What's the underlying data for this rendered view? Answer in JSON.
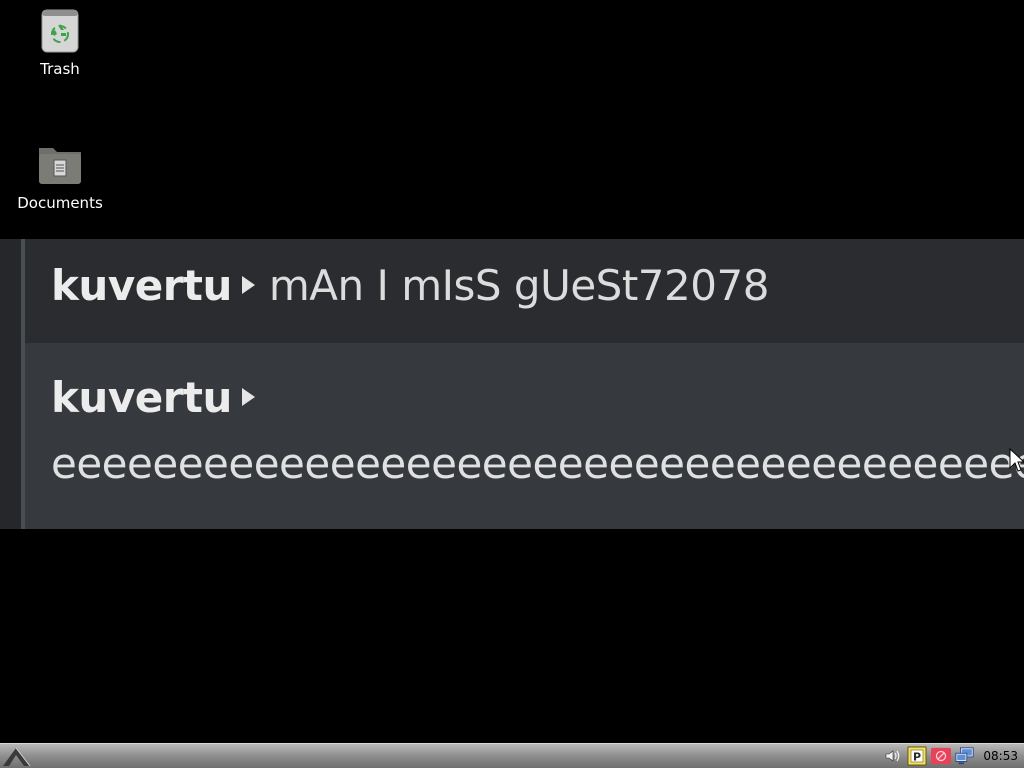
{
  "desktop": {
    "icons": [
      {
        "id": "trash",
        "label": "Trash",
        "icon": "trash-icon"
      },
      {
        "id": "documents",
        "label": "Documents",
        "icon": "folder-documents-icon"
      }
    ]
  },
  "chat": {
    "messages": [
      {
        "author": "kuvertu",
        "text": "mAn I mIsS gUeSt72078"
      },
      {
        "author": "kuvertu",
        "text": "eeeeeeeeeeeeeeeeeeeeeeeeeeeeeeeeeeeeeeeeee"
      }
    ]
  },
  "taskbar": {
    "tray_icons": [
      "volume-icon",
      "p-icon",
      "record-icon",
      "network-icon"
    ],
    "clock": "08:53"
  },
  "colors": {
    "background": "#000000",
    "chat_row_dark": "#2a2c2f",
    "chat_row_light": "#36393d",
    "taskbar": "#8e8e8e"
  }
}
